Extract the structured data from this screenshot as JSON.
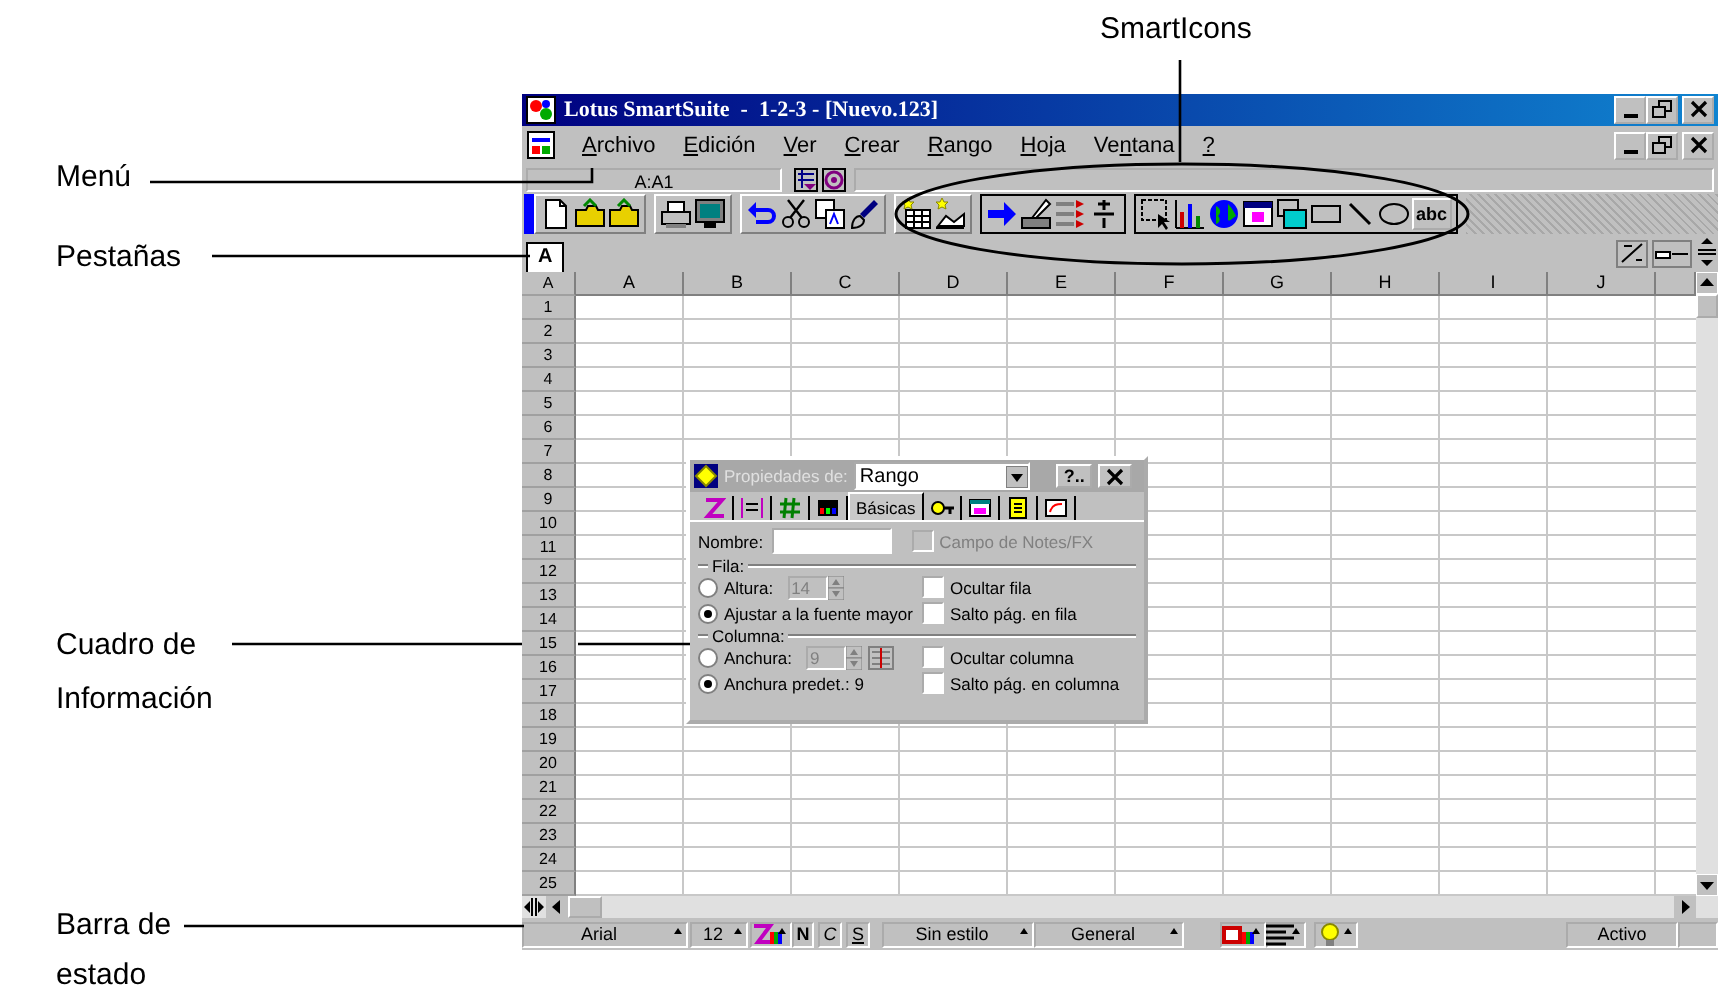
{
  "callouts": [
    {
      "text": "SmartIcons"
    },
    {
      "text": "Menú"
    },
    {
      "text": "Pestañas"
    },
    {
      "text": "Cuadro de Información"
    },
    {
      "text": "Barra de estado"
    }
  ],
  "app": {
    "title": "Lotus SmartSuite  -  1-2-3 - [Nuevo.123]",
    "menu": [
      {
        "label": "Archivo"
      },
      {
        "label": "Edición"
      },
      {
        "label": "Ver"
      },
      {
        "label": "Crear"
      },
      {
        "label": "Rango"
      },
      {
        "label": "Hoja"
      },
      {
        "label": "Ventana"
      },
      {
        "label": "?"
      }
    ],
    "cell_ref": "A:A1",
    "text_tool": "abc",
    "sheet_tabs": [
      {
        "label": "A",
        "selected": true
      }
    ],
    "corner": "A",
    "columns": [
      "A",
      "B",
      "C",
      "D",
      "E",
      "F",
      "G",
      "H",
      "I",
      "J"
    ],
    "rows": [
      "1",
      "2",
      "3",
      "4",
      "5",
      "6",
      "7",
      "8",
      "9",
      "10",
      "11",
      "12",
      "13",
      "14",
      "15",
      "16",
      "17",
      "18",
      "19",
      "20",
      "21",
      "22",
      "23",
      "24",
      "25"
    ],
    "dialog": {
      "title": "Propiedades de:",
      "object": "Rango",
      "help": "?..",
      "tabs": [
        {
          "kind": "icon",
          "selected": false
        },
        {
          "kind": "icon",
          "selected": false
        },
        {
          "kind": "icon",
          "selected": false
        },
        {
          "kind": "icon",
          "selected": false
        },
        {
          "kind": "text",
          "label": "Básicas",
          "selected": true
        },
        {
          "kind": "icon",
          "selected": false
        },
        {
          "kind": "icon",
          "selected": false
        },
        {
          "kind": "icon",
          "selected": false
        },
        {
          "kind": "icon",
          "selected": false
        }
      ],
      "name_label": "Nombre:",
      "notes_checkbox": {
        "label": "Campo de Notes/FX",
        "checked": false,
        "disabled": true
      },
      "groups": [
        {
          "title": "Fila:",
          "options": [
            {
              "label": "Altura:",
              "selected": false,
              "value": "14"
            },
            {
              "label": "Ajustar a la fuente mayor",
              "selected": true
            }
          ],
          "checkboxes": [
            {
              "label": "Ocultar fila",
              "checked": false
            },
            {
              "label": "Salto pág. en fila",
              "checked": false
            }
          ]
        },
        {
          "title": "Columna:",
          "options": [
            {
              "label": "Anchura:",
              "selected": false,
              "value": "9"
            },
            {
              "label": "Anchura predet.: 9",
              "selected": true
            }
          ],
          "checkboxes": [
            {
              "label": "Ocultar columna",
              "checked": false
            },
            {
              "label": "Salto pág. en columna",
              "checked": false
            }
          ]
        }
      ]
    },
    "status_bar": [
      {
        "kind": "dropdown",
        "text": "Arial"
      },
      {
        "kind": "dropdown",
        "text": "12"
      },
      {
        "kind": "icon_dropdown"
      },
      {
        "kind": "toggle",
        "text": "N"
      },
      {
        "kind": "toggle",
        "text": "C"
      },
      {
        "kind": "toggle",
        "text": "S"
      },
      {
        "kind": "dropdown",
        "text": "Sin estilo"
      },
      {
        "kind": "dropdown",
        "text": "General"
      },
      {
        "kind": "icon_dropdown"
      },
      {
        "kind": "icon_dropdown"
      },
      {
        "kind": "icon_dropdown"
      },
      {
        "kind": "field",
        "text": "Activo"
      }
    ]
  }
}
